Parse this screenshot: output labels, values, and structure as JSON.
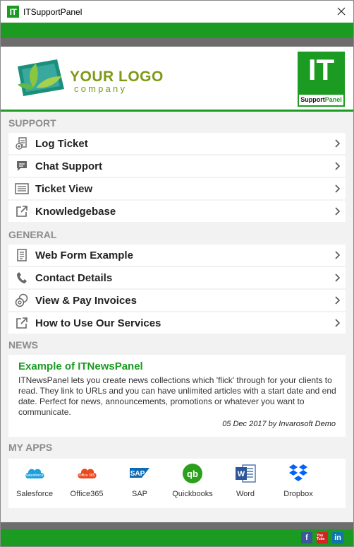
{
  "window": {
    "title": "ITSupportPanel",
    "app_icon_text": "IT"
  },
  "header": {
    "logo_main": "YOUR LOGO",
    "logo_sub": "company",
    "brand_big": "IT",
    "brand_foot_a": "Support",
    "brand_foot_b": "Panel"
  },
  "colors": {
    "brand_green": "#1c9b22",
    "band_grey": "#6d6d6d",
    "logo_olive": "#7e9a18"
  },
  "sections": {
    "support": {
      "title": "SUPPORT",
      "items": [
        {
          "label": "Log Ticket",
          "icon": "log-ticket-icon"
        },
        {
          "label": "Chat Support",
          "icon": "chat-icon"
        },
        {
          "label": "Ticket View",
          "icon": "ticket-view-icon"
        },
        {
          "label": "Knowledgebase",
          "icon": "external-link-icon"
        }
      ]
    },
    "general": {
      "title": "GENERAL",
      "items": [
        {
          "label": "Web Form Example",
          "icon": "document-icon"
        },
        {
          "label": "Contact Details",
          "icon": "phone-icon"
        },
        {
          "label": "View & Pay Invoices",
          "icon": "coins-icon"
        },
        {
          "label": "How to Use Our Services",
          "icon": "external-link-icon"
        }
      ]
    },
    "news": {
      "title": "NEWS",
      "item_title": "Example of ITNewsPanel",
      "item_body": "ITNewsPanel lets you create news collections which 'flick' through for your clients to read. They link to URLs and you can have unlimited articles with a start date and end date. Perfect for news, announcements, promotions or whatever you want to communicate.",
      "item_meta": "05 Dec 2017 by Invarosoft Demo"
    },
    "apps": {
      "title": "MY APPS",
      "items": [
        {
          "label": "Salesforce",
          "icon": "salesforce-icon",
          "icon_text": "salesforce"
        },
        {
          "label": "Office365",
          "icon": "office365-icon",
          "icon_text": "Office 365"
        },
        {
          "label": "SAP",
          "icon": "sap-icon",
          "icon_text": "SAP"
        },
        {
          "label": "Quickbooks",
          "icon": "quickbooks-icon",
          "icon_text": "qb"
        },
        {
          "label": "Word",
          "icon": "word-icon",
          "icon_text": "W"
        },
        {
          "label": "Dropbox",
          "icon": "dropbox-icon",
          "icon_text": ""
        }
      ]
    }
  },
  "footer": {
    "social": [
      {
        "label": "f",
        "icon": "facebook-icon",
        "color": "#3b5998"
      },
      {
        "label": "You Tube",
        "icon": "youtube-icon",
        "color": "#d32323"
      },
      {
        "label": "in",
        "icon": "linkedin-icon",
        "color": "#0e76a8"
      }
    ]
  }
}
